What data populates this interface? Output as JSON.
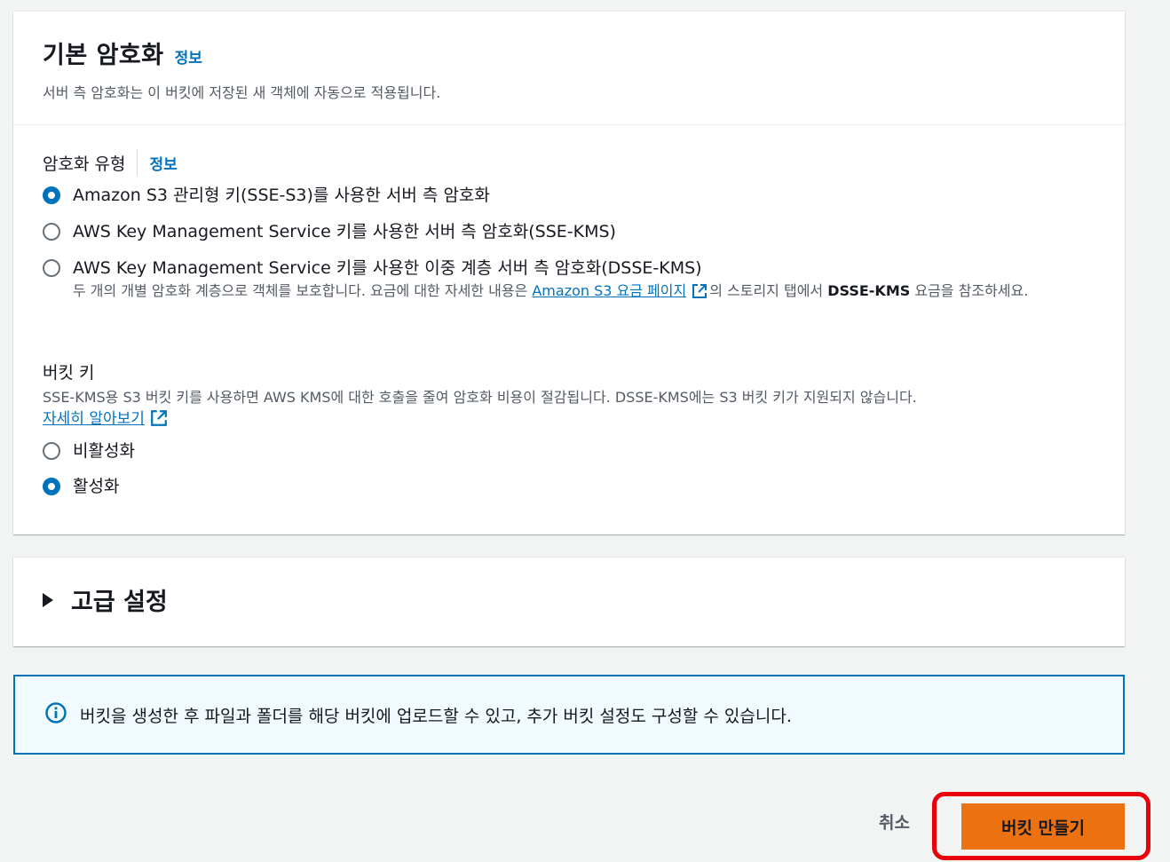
{
  "default_encryption": {
    "title": "기본 암호화",
    "info": "정보",
    "description": "서버 측 암호화는 이 버킷에 저장된 새 객체에 자동으로 적용됩니다."
  },
  "encryption_type": {
    "label": "암호화 유형",
    "info": "정보",
    "options": [
      {
        "label": "Amazon S3 관리형 키(SSE-S3)를 사용한 서버 측 암호화",
        "selected": true
      },
      {
        "label": "AWS Key Management Service 키를 사용한 서버 측 암호화(SSE-KMS)",
        "selected": false
      },
      {
        "label": "AWS Key Management Service 키를 사용한 이중 계층 서버 측 암호화(DSSE-KMS)",
        "selected": false,
        "desc_before": "두 개의 개별 암호화 계층으로 객체를 보호합니다. 요금에 대한 자세한 내용은 ",
        "desc_link": "Amazon S3 요금 페이지",
        "desc_mid": "의 스토리지 탭에서 ",
        "desc_bold": "DSSE-KMS",
        "desc_after": " 요금을 참조하세요."
      }
    ]
  },
  "bucket_key": {
    "label": "버킷 키",
    "description": "SSE-KMS용 S3 버킷 키를 사용하면 AWS KMS에 대한 호출을 줄여 암호화 비용이 절감됩니다. DSSE-KMS에는 S3 버킷 키가 지원되지 않습니다.",
    "learn_more": "자세히 알아보기",
    "options": [
      {
        "label": "비활성화",
        "selected": false
      },
      {
        "label": "활성화",
        "selected": true
      }
    ]
  },
  "advanced": {
    "title": "고급 설정"
  },
  "alert": {
    "text": "버킷을 생성한 후 파일과 폴더를 해당 버킷에 업로드할 수 있고, 추가 버킷 설정도 구성할 수 있습니다."
  },
  "actions": {
    "cancel": "취소",
    "create": "버킷 만들기"
  },
  "colors": {
    "accent": "#0073bb",
    "primary_button": "#ec7211",
    "highlight": "#e8000b"
  },
  "icons": {
    "external": "external-link-icon",
    "info": "info-circle-icon",
    "caret": "caret-right-icon"
  }
}
